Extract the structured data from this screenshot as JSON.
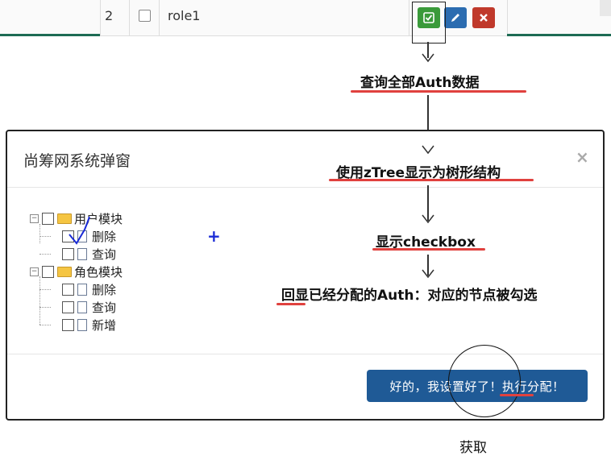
{
  "table_row": {
    "index": "2",
    "role_name": "role1",
    "actions": [
      {
        "name": "assign",
        "icon": "check-square-icon",
        "color": "#3a9a3a"
      },
      {
        "name": "edit",
        "icon": "pencil-icon",
        "color": "#2b6cb0"
      },
      {
        "name": "delete",
        "icon": "close-icon",
        "color": "#c0392b"
      }
    ]
  },
  "annotations": {
    "step1": "查询全部Auth数据",
    "step2": "使用zTree显示为树形结构",
    "step3": "显示checkbox",
    "step4": "回显已经分配的Auth：对应的节点被勾选",
    "fetch": "获取"
  },
  "modal": {
    "title": "尚筹网系统弹窗",
    "close_glyph": "×",
    "submit_label": "好的，我设置好了！执行分配！"
  },
  "tree": {
    "groups": [
      {
        "label": "用户模块",
        "children": [
          "删除",
          "查询"
        ]
      },
      {
        "label": "角色模块",
        "children": [
          "删除",
          "查询",
          "新增"
        ]
      }
    ]
  },
  "plus_glyph": "+",
  "colors": {
    "accent_underline": "#e0413e",
    "submit_button": "#1f5a96",
    "table_divider": "#1d6b54"
  }
}
